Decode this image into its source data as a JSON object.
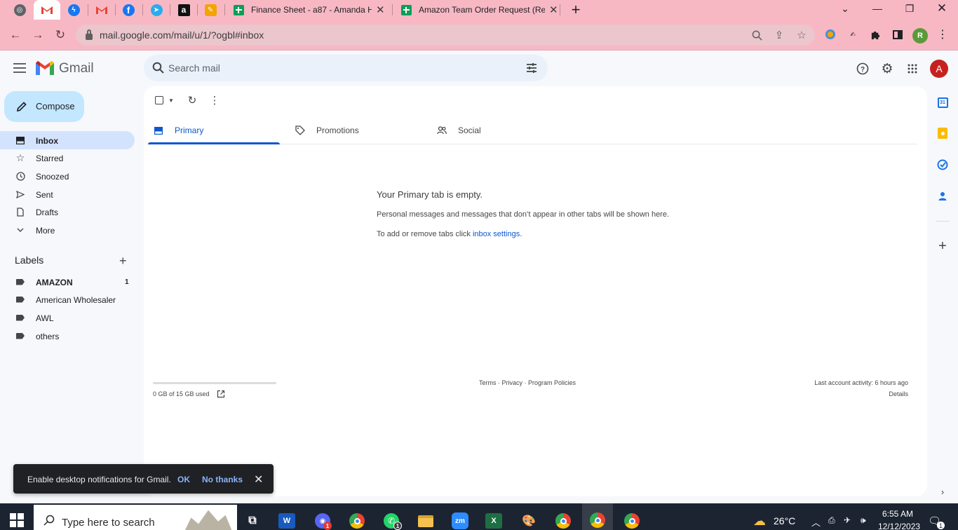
{
  "browser": {
    "pinned_tabs": [
      {
        "name": "chrome-web-icon",
        "color": "#5f6368"
      },
      {
        "name": "gmail-tab-icon",
        "color": "#ea4335"
      },
      {
        "name": "messenger-icon",
        "color": "#1877f2"
      },
      {
        "name": "gmail-tab-icon-2",
        "color": "#ea4335"
      },
      {
        "name": "facebook-icon",
        "color": "#1877f2"
      },
      {
        "name": "telegram-icon",
        "color": "#2aabee"
      },
      {
        "name": "amazon-icon",
        "color": "#111111"
      },
      {
        "name": "pen-app-icon",
        "color": "#f4a300"
      }
    ],
    "tabs": [
      {
        "title": "Finance Sheet - a87 - Amanda H"
      },
      {
        "title": "Amazon Team Order Request (Re"
      }
    ],
    "url": "mail.google.com/mail/u/1/?ogbl#inbox",
    "profile_initial": "R"
  },
  "gmail": {
    "brand": "Gmail",
    "search_placeholder": "Search mail",
    "account_initial": "A",
    "compose_label": "Compose",
    "nav": [
      {
        "label": "Inbox",
        "icon": "inbox-icon",
        "active": true
      },
      {
        "label": "Starred",
        "icon": "star-icon"
      },
      {
        "label": "Snoozed",
        "icon": "clock-icon"
      },
      {
        "label": "Sent",
        "icon": "send-icon"
      },
      {
        "label": "Drafts",
        "icon": "draft-icon"
      },
      {
        "label": "More",
        "icon": "chevron-down-icon"
      }
    ],
    "labels_heading": "Labels",
    "labels": [
      {
        "label": "AMAZON",
        "count": "1",
        "bold": true
      },
      {
        "label": "American Wholesaler"
      },
      {
        "label": "AWL"
      },
      {
        "label": "others"
      }
    ],
    "tabs": [
      {
        "label": "Primary",
        "icon": "inbox-icon"
      },
      {
        "label": "Promotions",
        "icon": "tag-icon"
      },
      {
        "label": "Social",
        "icon": "people-icon"
      }
    ],
    "empty": {
      "title": "Your Primary tab is empty.",
      "line1": "Personal messages and messages that don’t appear in other tabs will be shown here.",
      "line2_prefix": "To add or remove tabs click ",
      "line2_link": "inbox settings",
      "line2_suffix": "."
    },
    "storage": {
      "text": "0 GB of 15 GB used",
      "used_fraction": 0
    },
    "footer": {
      "links": "Terms · Privacy · Program Policies",
      "activity": "Last account activity: 6 hours ago",
      "details": "Details"
    },
    "snackbar": {
      "message": "Enable desktop notifications for Gmail.",
      "ok": "OK",
      "dismiss": "No thanks"
    }
  },
  "taskbar": {
    "search_placeholder": "Type here to search",
    "weather": "26°C",
    "time": "6:55 AM",
    "date": "12/12/2023",
    "notification_count": "1",
    "app_badges": {
      "discord": "1",
      "whatsapp": "1"
    }
  },
  "colors": {
    "accent": "#0b57d0",
    "compose": "#c2e7ff",
    "active_nav": "#d3e3fd",
    "browser_frame": "#f7b8c4"
  }
}
